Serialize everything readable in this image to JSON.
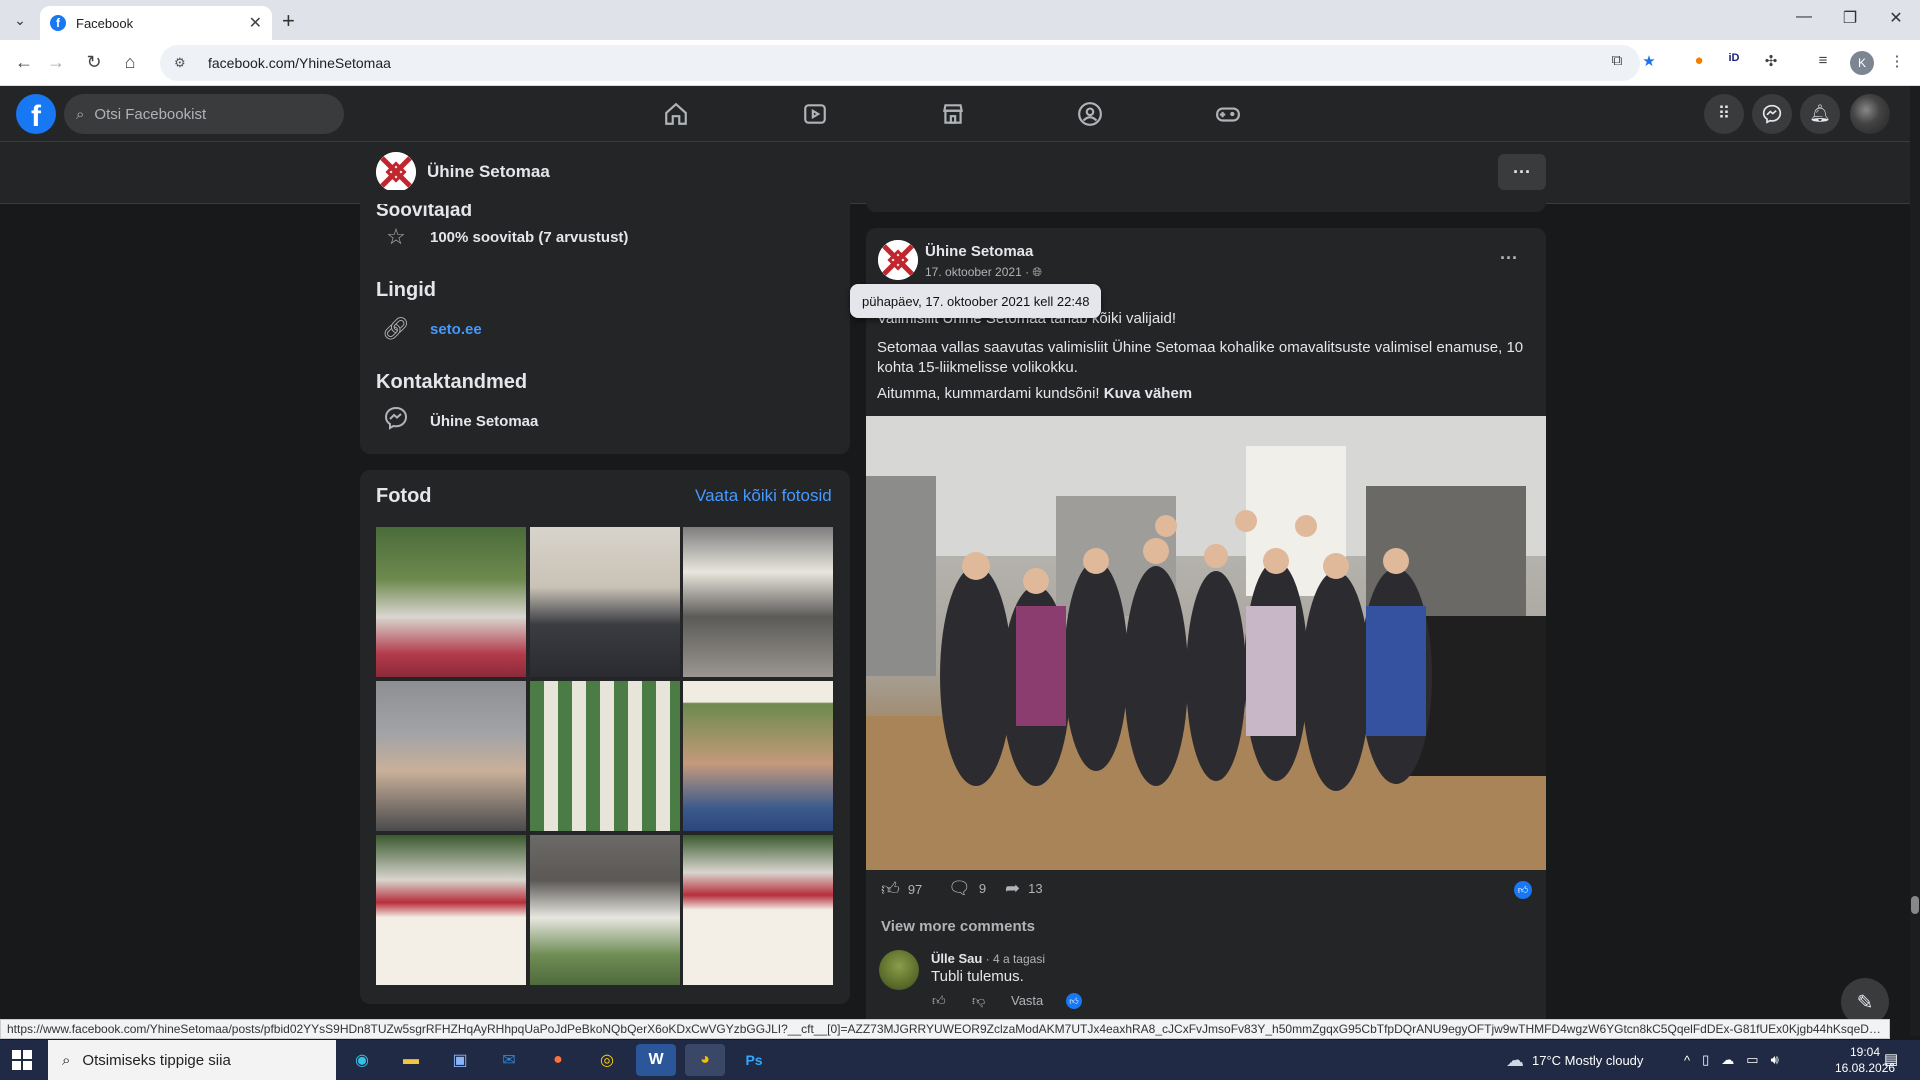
{
  "browser": {
    "tab_title": "Facebook",
    "url": "facebook.com/YhineSetomaa",
    "status_url": "https://www.facebook.com/YhineSetomaa/posts/pfbid02YYsS9HDn8TUZw5sgrRFHZHqAyRHhpqUaPoJdPeBkoNQbQerX6oKDxCwVGYzbGGJLI?__cft__[0]=AZZ73MJGRRYUWEOR9ZclzaModAKM7UTJx4eaxhRA8_cJCxFvJmsoFv83Y_h50mmZgqxG95CbTfpDQrANU9egyOFTjw9wTHMFD4wgzW6YGtcn8kC5QqelFdDEx-G81fUEx0Kjgb44hKsqeDGHvPa45h63JeKejc..."
  },
  "fb": {
    "search_placeholder": "Otsi Facebookist"
  },
  "page": {
    "name": "Ühine Setomaa"
  },
  "about": {
    "cut_heading": "Soovitajad",
    "recommend": "100% soovitab (7 arvustust)",
    "links_heading": "Lingid",
    "link": "seto.ee",
    "contact_heading": "Kontaktandmed",
    "contact": "Ühine Setomaa"
  },
  "photos": {
    "title": "Fotod",
    "see_all": "Vaata kõiki fotosid"
  },
  "post": {
    "author": "Ühine Setomaa",
    "date": "17. oktoober 2021 · ",
    "tooltip": "pühapäev, 17. oktoober 2021 kell 22:48",
    "line1": "Valimisliit Ühine Setomaa tänab kõiki valijaid!",
    "line2": "Setomaa vallas saavutas valimisliit Ühine Setomaa kohalike omavalitsuste valimisel enamuse, 10 kohta 15-liikmelisse volikokku.",
    "line3": "Aitumma, kummardami kundsõni! ",
    "see_less": "Kuva vähem",
    "likes": "97",
    "comments": "9",
    "shares": "13",
    "view_more": "View more comments"
  },
  "comment": {
    "author": "Ülle Sau",
    "time": " · 4 a tagasi",
    "text": "Tubli tulemus.",
    "reply": "Vasta"
  },
  "taskbar": {
    "search": "Otsimiseks tippige siia",
    "weather": "17°C  Mostly cloudy",
    "time": "19:04",
    "date": "16.08.2026"
  }
}
